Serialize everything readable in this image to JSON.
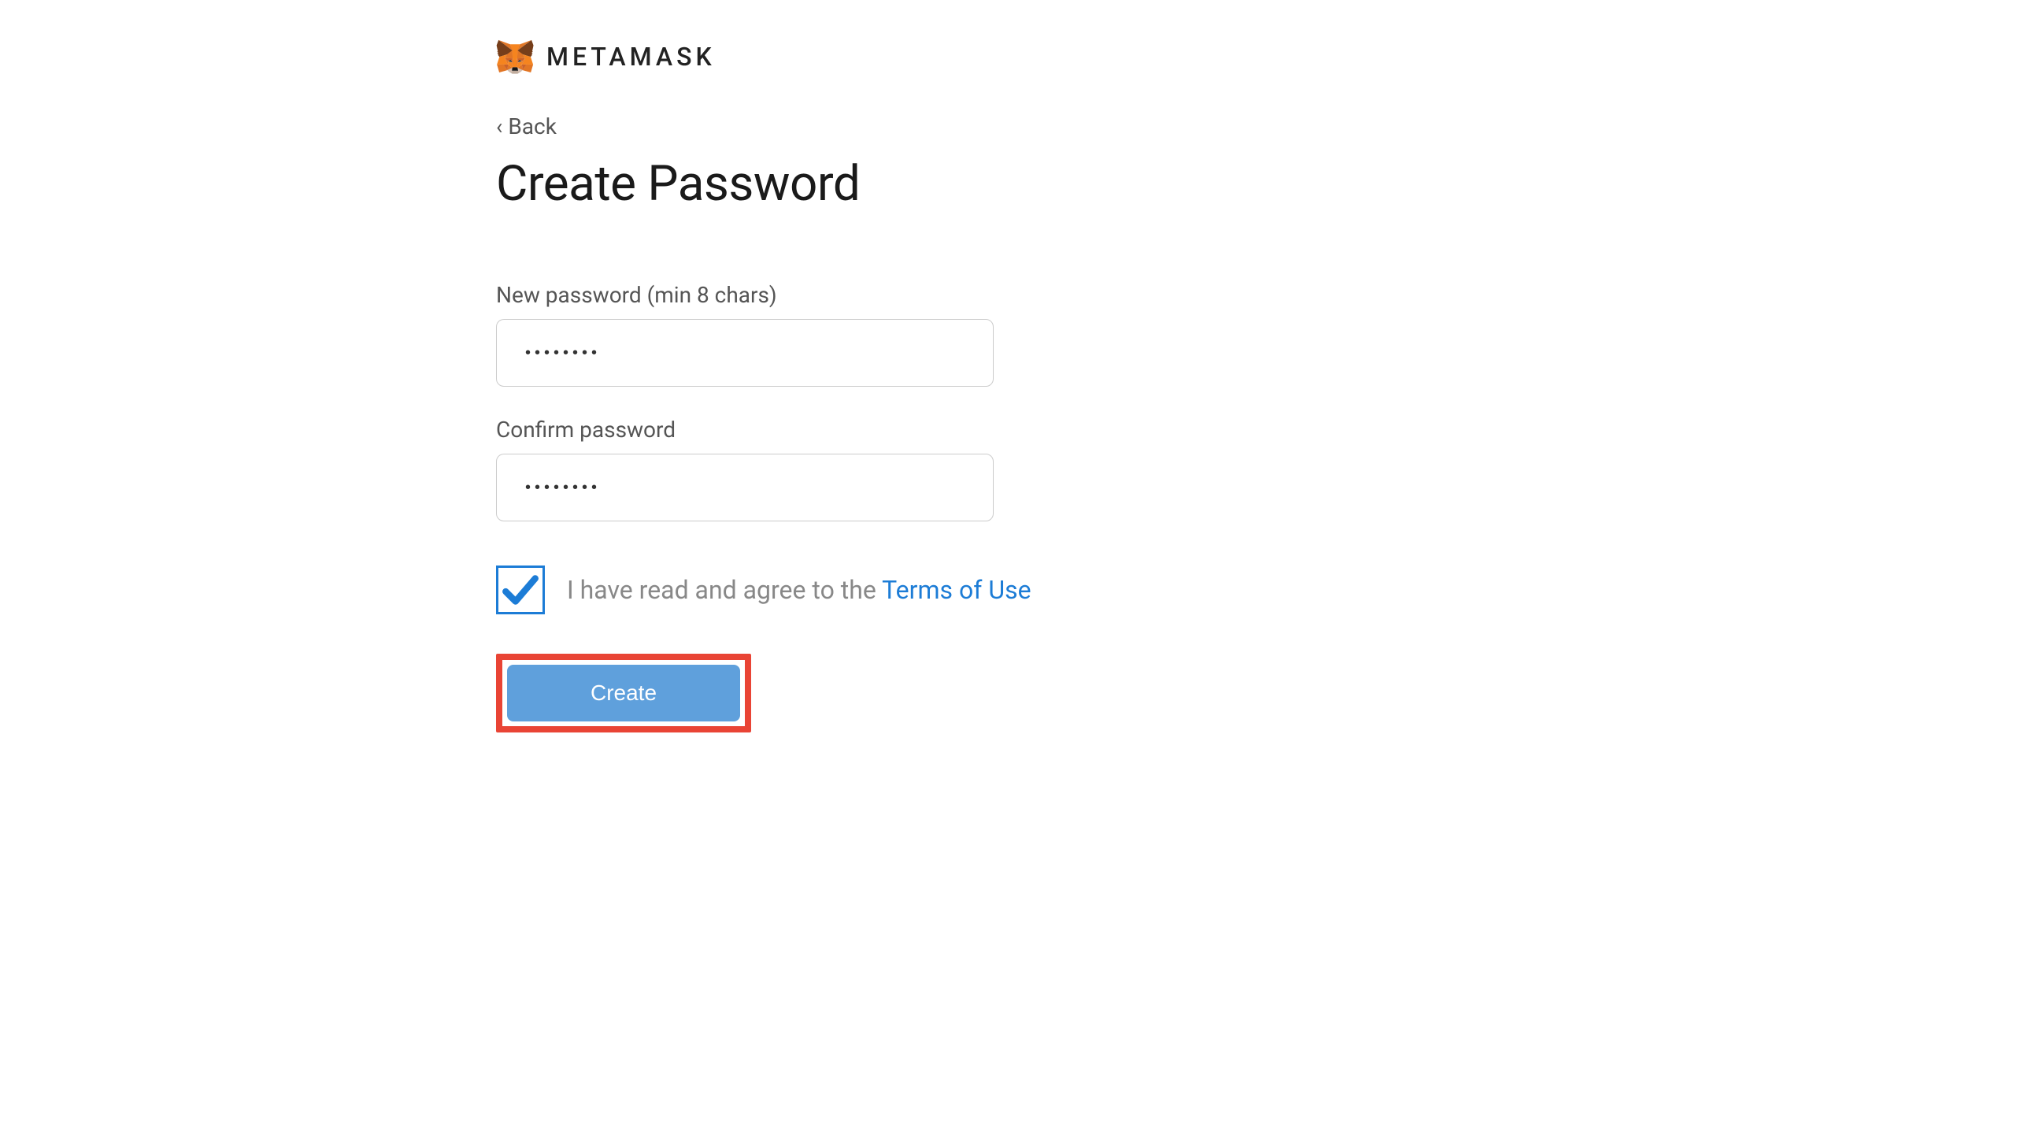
{
  "brand": {
    "name": "METAMASK"
  },
  "nav": {
    "back": "Back"
  },
  "page": {
    "title": "Create Password"
  },
  "form": {
    "new_password_label": "New password (min 8 chars)",
    "new_password_value": "••••••••",
    "confirm_password_label": "Confirm password",
    "confirm_password_value": "••••••••",
    "terms_prefix": "I have read and agree to the ",
    "terms_link_text": "Terms of Use",
    "terms_checked": true,
    "create_button": "Create"
  }
}
